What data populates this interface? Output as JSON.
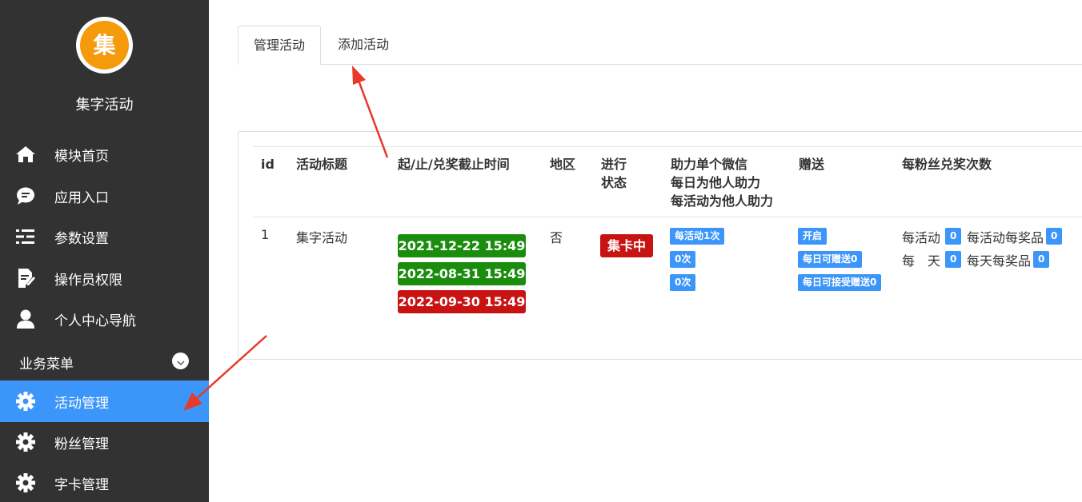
{
  "sidebar": {
    "logo_char": "集",
    "app_name": "集字活动",
    "items": [
      {
        "label": "模块首页",
        "icon": "home-icon"
      },
      {
        "label": "应用入口",
        "icon": "chat-icon"
      },
      {
        "label": "参数设置",
        "icon": "list-settings-icon"
      },
      {
        "label": "操作员权限",
        "icon": "document-edit-icon"
      },
      {
        "label": "个人中心导航",
        "icon": "user-icon"
      }
    ],
    "section_title": "业务菜单",
    "business_items": [
      {
        "label": "活动管理",
        "icon": "gear-icon",
        "active": true
      },
      {
        "label": "粉丝管理",
        "icon": "gear-icon",
        "active": false
      },
      {
        "label": "字卡管理",
        "icon": "gear-icon",
        "active": false
      }
    ]
  },
  "tabs": [
    {
      "label": "管理活动",
      "active": true
    },
    {
      "label": "添加活动",
      "active": false
    }
  ],
  "table": {
    "headers": {
      "id": "id",
      "title": "活动标题",
      "time": "起/止/兑奖截止时间",
      "region": "地区",
      "status_line1": "进行",
      "status_line2": "状态",
      "assist_line1": "助力单个微信",
      "assist_line2": "每日为他人助力",
      "assist_line3": "每活动为他人助力",
      "gift": "赠送",
      "redeem": "每粉丝兑奖次数"
    },
    "row": {
      "id": "1",
      "title": "集字活动",
      "start": "2021-12-22 15:49",
      "end": "2022-08-31 15:49",
      "deadline": "2022-09-30 15:49",
      "region": "否",
      "status": "集卡中",
      "assist_per_activity": "每活动1次",
      "assist_daily": "0次",
      "assist_activity": "0次",
      "gift_enabled": "开启",
      "gift_daily_give": "每日可赠送0",
      "gift_daily_receive": "每日可接受赠送0",
      "redeem_activity_label": "每活动",
      "redeem_activity_value": "0",
      "redeem_activity_prize_label": "每活动每奖品",
      "redeem_activity_prize_value": "0",
      "redeem_day_label_a": "每",
      "redeem_day_label_b": "天",
      "redeem_day_value": "0",
      "redeem_day_prize_label": "每天每奖品",
      "redeem_day_prize_value": "0"
    }
  },
  "colors": {
    "sidebar_bg": "#323232",
    "active_blue": "#3c95f8",
    "logo_orange": "#f59a0b",
    "badge_green": "#1a8e0c",
    "badge_red": "#c81313",
    "annotation_arrow": "#e8392b"
  }
}
